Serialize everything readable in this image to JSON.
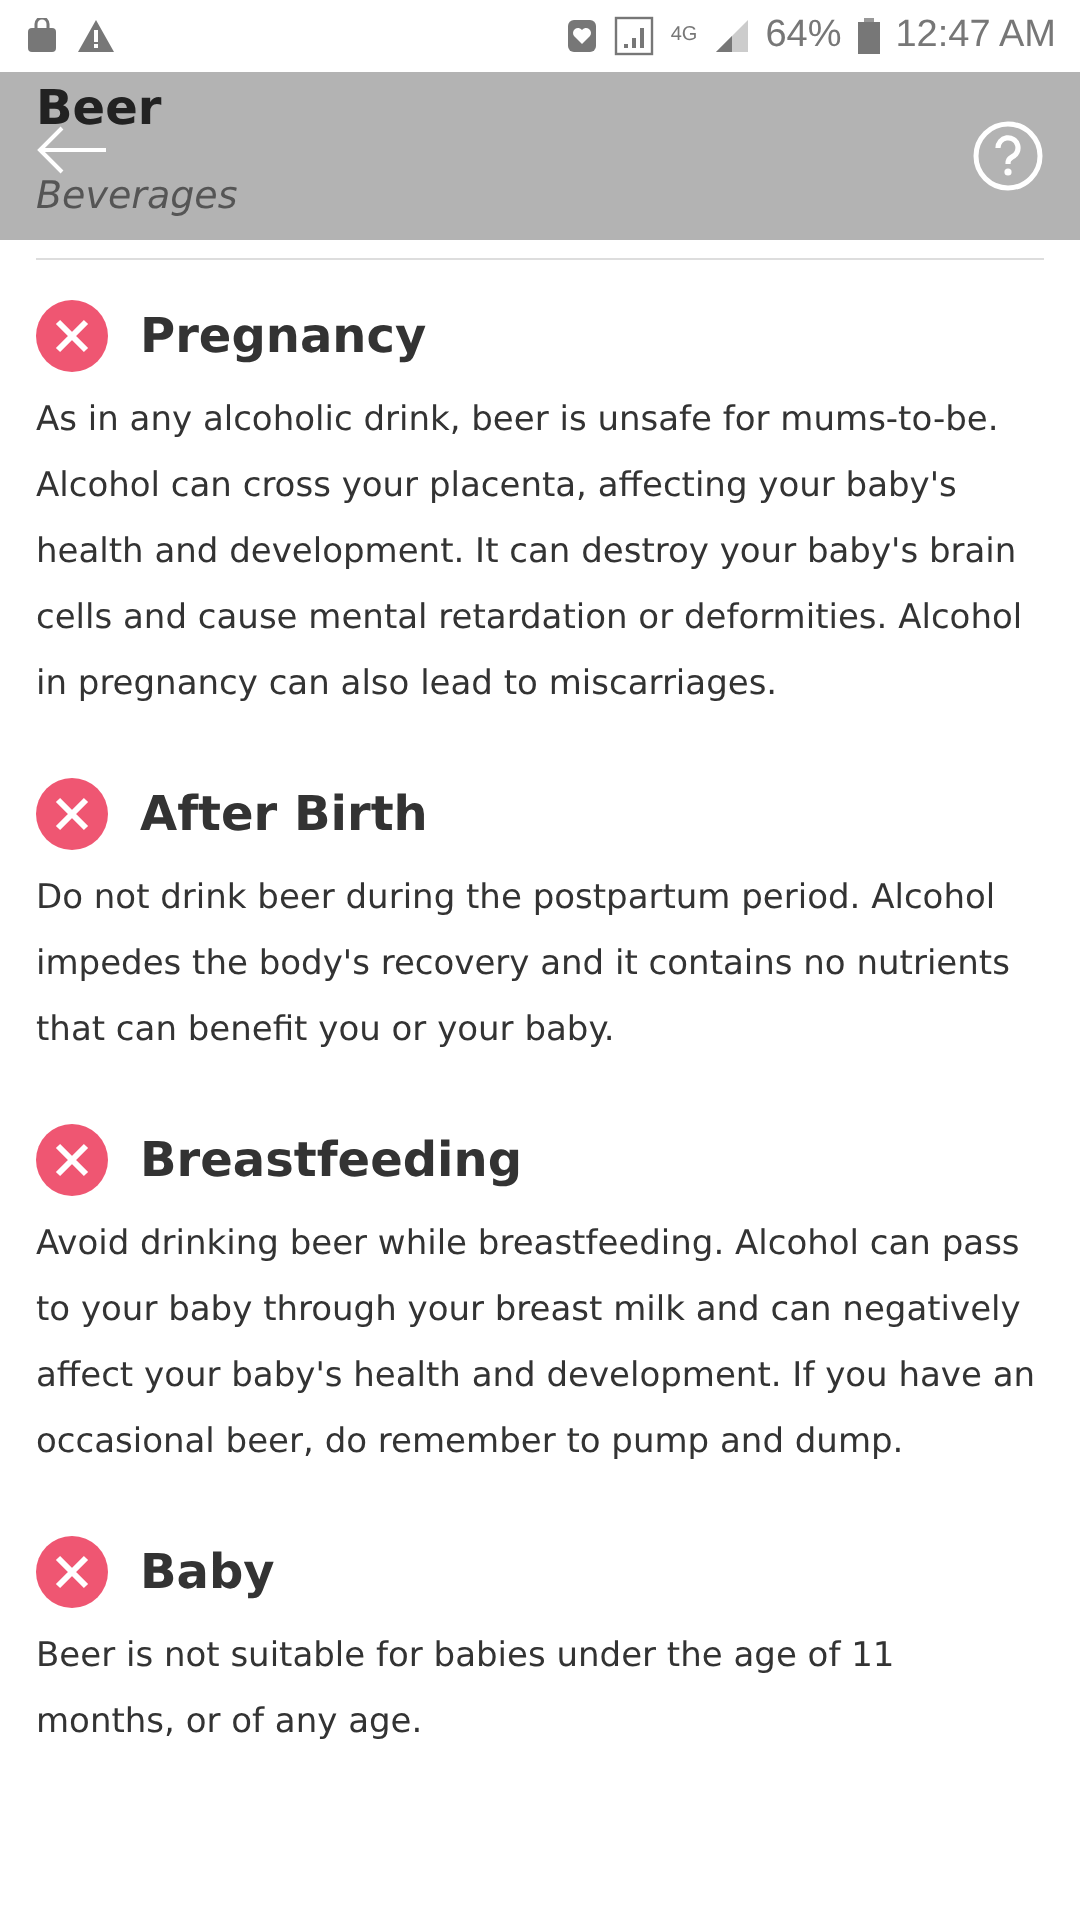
{
  "status_bar": {
    "battery": "64%",
    "time": "12:47 AM",
    "network": "4G"
  },
  "header": {
    "title": "Beer",
    "subtitle": "Beverages"
  },
  "sections": [
    {
      "title": "Pregnancy",
      "safe": false,
      "text": "As in any alcoholic drink, beer is unsafe for mums-to-be. Alcohol can cross your placenta, affecting your baby's health and development. It can destroy your baby's brain cells and cause mental retardation or deformities. Alcohol in pregnancy can also lead to miscarriages."
    },
    {
      "title": "After Birth",
      "safe": false,
      "text": "Do not drink beer during the postpartum period. Alcohol impedes the body's recovery and it contains no nutrients that can benefit you or your baby."
    },
    {
      "title": "Breastfeeding",
      "safe": false,
      "text": "Avoid drinking beer while breastfeeding. Alcohol can pass to your baby through your breast milk and can negatively affect your baby's health and development. If you have an occasional beer, do remember to pump and dump."
    },
    {
      "title": "Baby",
      "safe": false,
      "text": "Beer is not suitable for babies under the age of 11 months, or of any age."
    }
  ]
}
